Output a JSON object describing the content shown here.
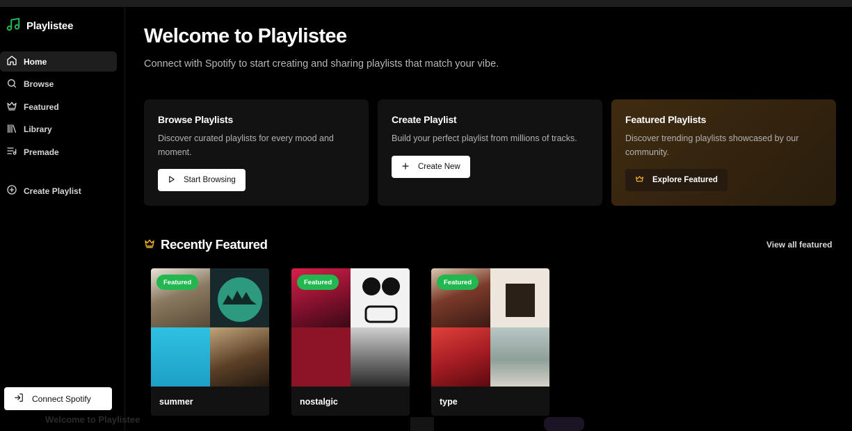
{
  "app": {
    "name": "Playlistee",
    "logo_icon": "music-note-icon",
    "accent": "#22b84f"
  },
  "sidebar": {
    "items": [
      {
        "label": "Home",
        "icon": "home-icon",
        "active": true
      },
      {
        "label": "Browse",
        "icon": "search-icon",
        "active": false
      },
      {
        "label": "Featured",
        "icon": "crown-icon",
        "active": false
      },
      {
        "label": "Library",
        "icon": "library-icon",
        "active": false
      },
      {
        "label": "Premade",
        "icon": "list-icon",
        "active": false
      }
    ],
    "create_label": "Create Playlist",
    "connect_label": "Connect Spotify"
  },
  "header": {
    "title": "Welcome to Playlistee",
    "subtitle": "Connect with Spotify to start creating and sharing playlists that match your vibe."
  },
  "cards": [
    {
      "title": "Browse Playlists",
      "description": "Discover curated playlists for every mood and moment.",
      "button": "Start Browsing",
      "icon": "play-icon"
    },
    {
      "title": "Create Playlist",
      "description": "Build your perfect playlist from millions of tracks.",
      "button": "Create New",
      "icon": "plus-icon"
    },
    {
      "title": "Featured Playlists",
      "description": "Discover trending playlists showcased by our community.",
      "button": "Explore Featured",
      "icon": "crown-icon"
    }
  ],
  "recent": {
    "title": "Recently Featured",
    "view_all": "View all featured",
    "playlists": [
      {
        "name": "summer",
        "badge": "Featured",
        "tile_colors": [
          "#6b5a45",
          "#1d3a3a",
          "#2bb5d6",
          "#4a3a2a"
        ]
      },
      {
        "name": "nostalgic",
        "badge": "Featured",
        "tile_colors": [
          "#8a1230",
          "#f2f2f2",
          "#7a1020",
          "#3a3a3a"
        ]
      },
      {
        "name": "type",
        "badge": "Featured",
        "tile_colors": [
          "#6a3a2a",
          "#e8e0d4",
          "#b3262e",
          "#9aa8a4"
        ]
      }
    ]
  },
  "background_echo": {
    "title": "Welcome to Playlistee"
  }
}
